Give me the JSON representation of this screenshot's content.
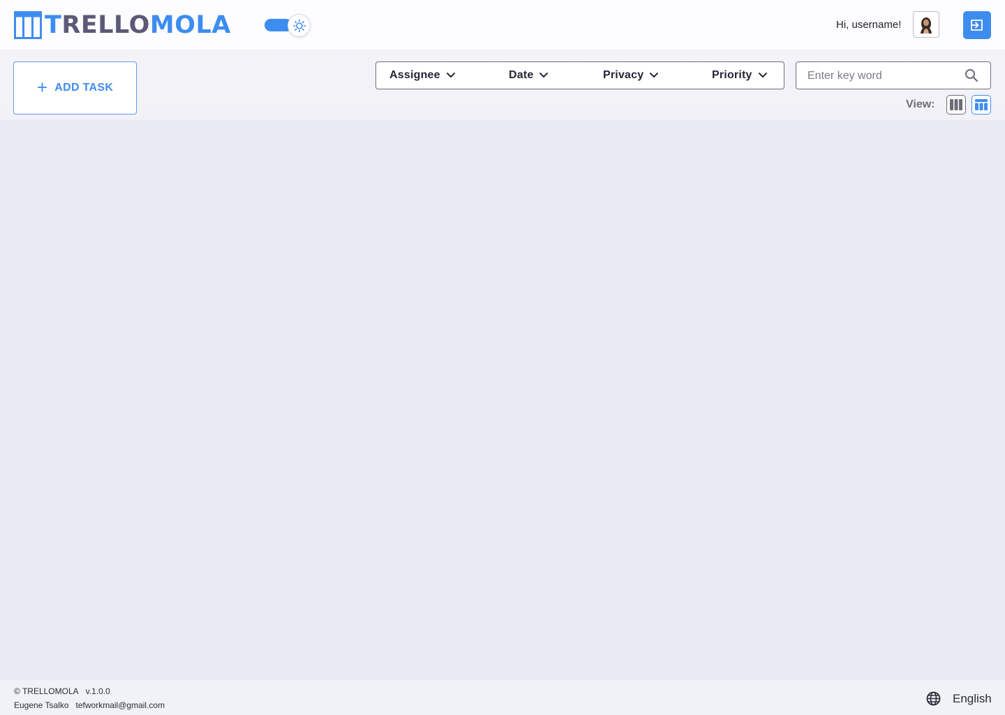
{
  "header": {
    "logo_text_1": "T",
    "logo_text_2": "RELLO",
    "logo_text_3": "MOLA",
    "greeting": "Hi, username!"
  },
  "toolbar": {
    "add_task_plus": "+",
    "add_task_label": "ADD TASK",
    "filters": [
      {
        "label": "Assignee"
      },
      {
        "label": "Date"
      },
      {
        "label": "Privacy"
      },
      {
        "label": "Priority"
      }
    ],
    "search_placeholder": "Enter key word",
    "view_label": "View:"
  },
  "footer": {
    "copyright": "© TRELLOMOLA",
    "version": "v.1.0.0",
    "author": "Eugene Tsalko",
    "email": "tefworkmail@gmail.com",
    "language": "English"
  },
  "colors": {
    "accent": "#3d8df0",
    "logo_secondary": "#5c5a78",
    "background": "#e8ebf4"
  },
  "icons": {
    "logo": "board-columns-icon",
    "theme": "sun-icon",
    "logout": "logout-icon",
    "search": "search-icon",
    "view_kanban": "kanban-view-icon",
    "view_table": "table-view-icon",
    "language": "globe-icon"
  }
}
